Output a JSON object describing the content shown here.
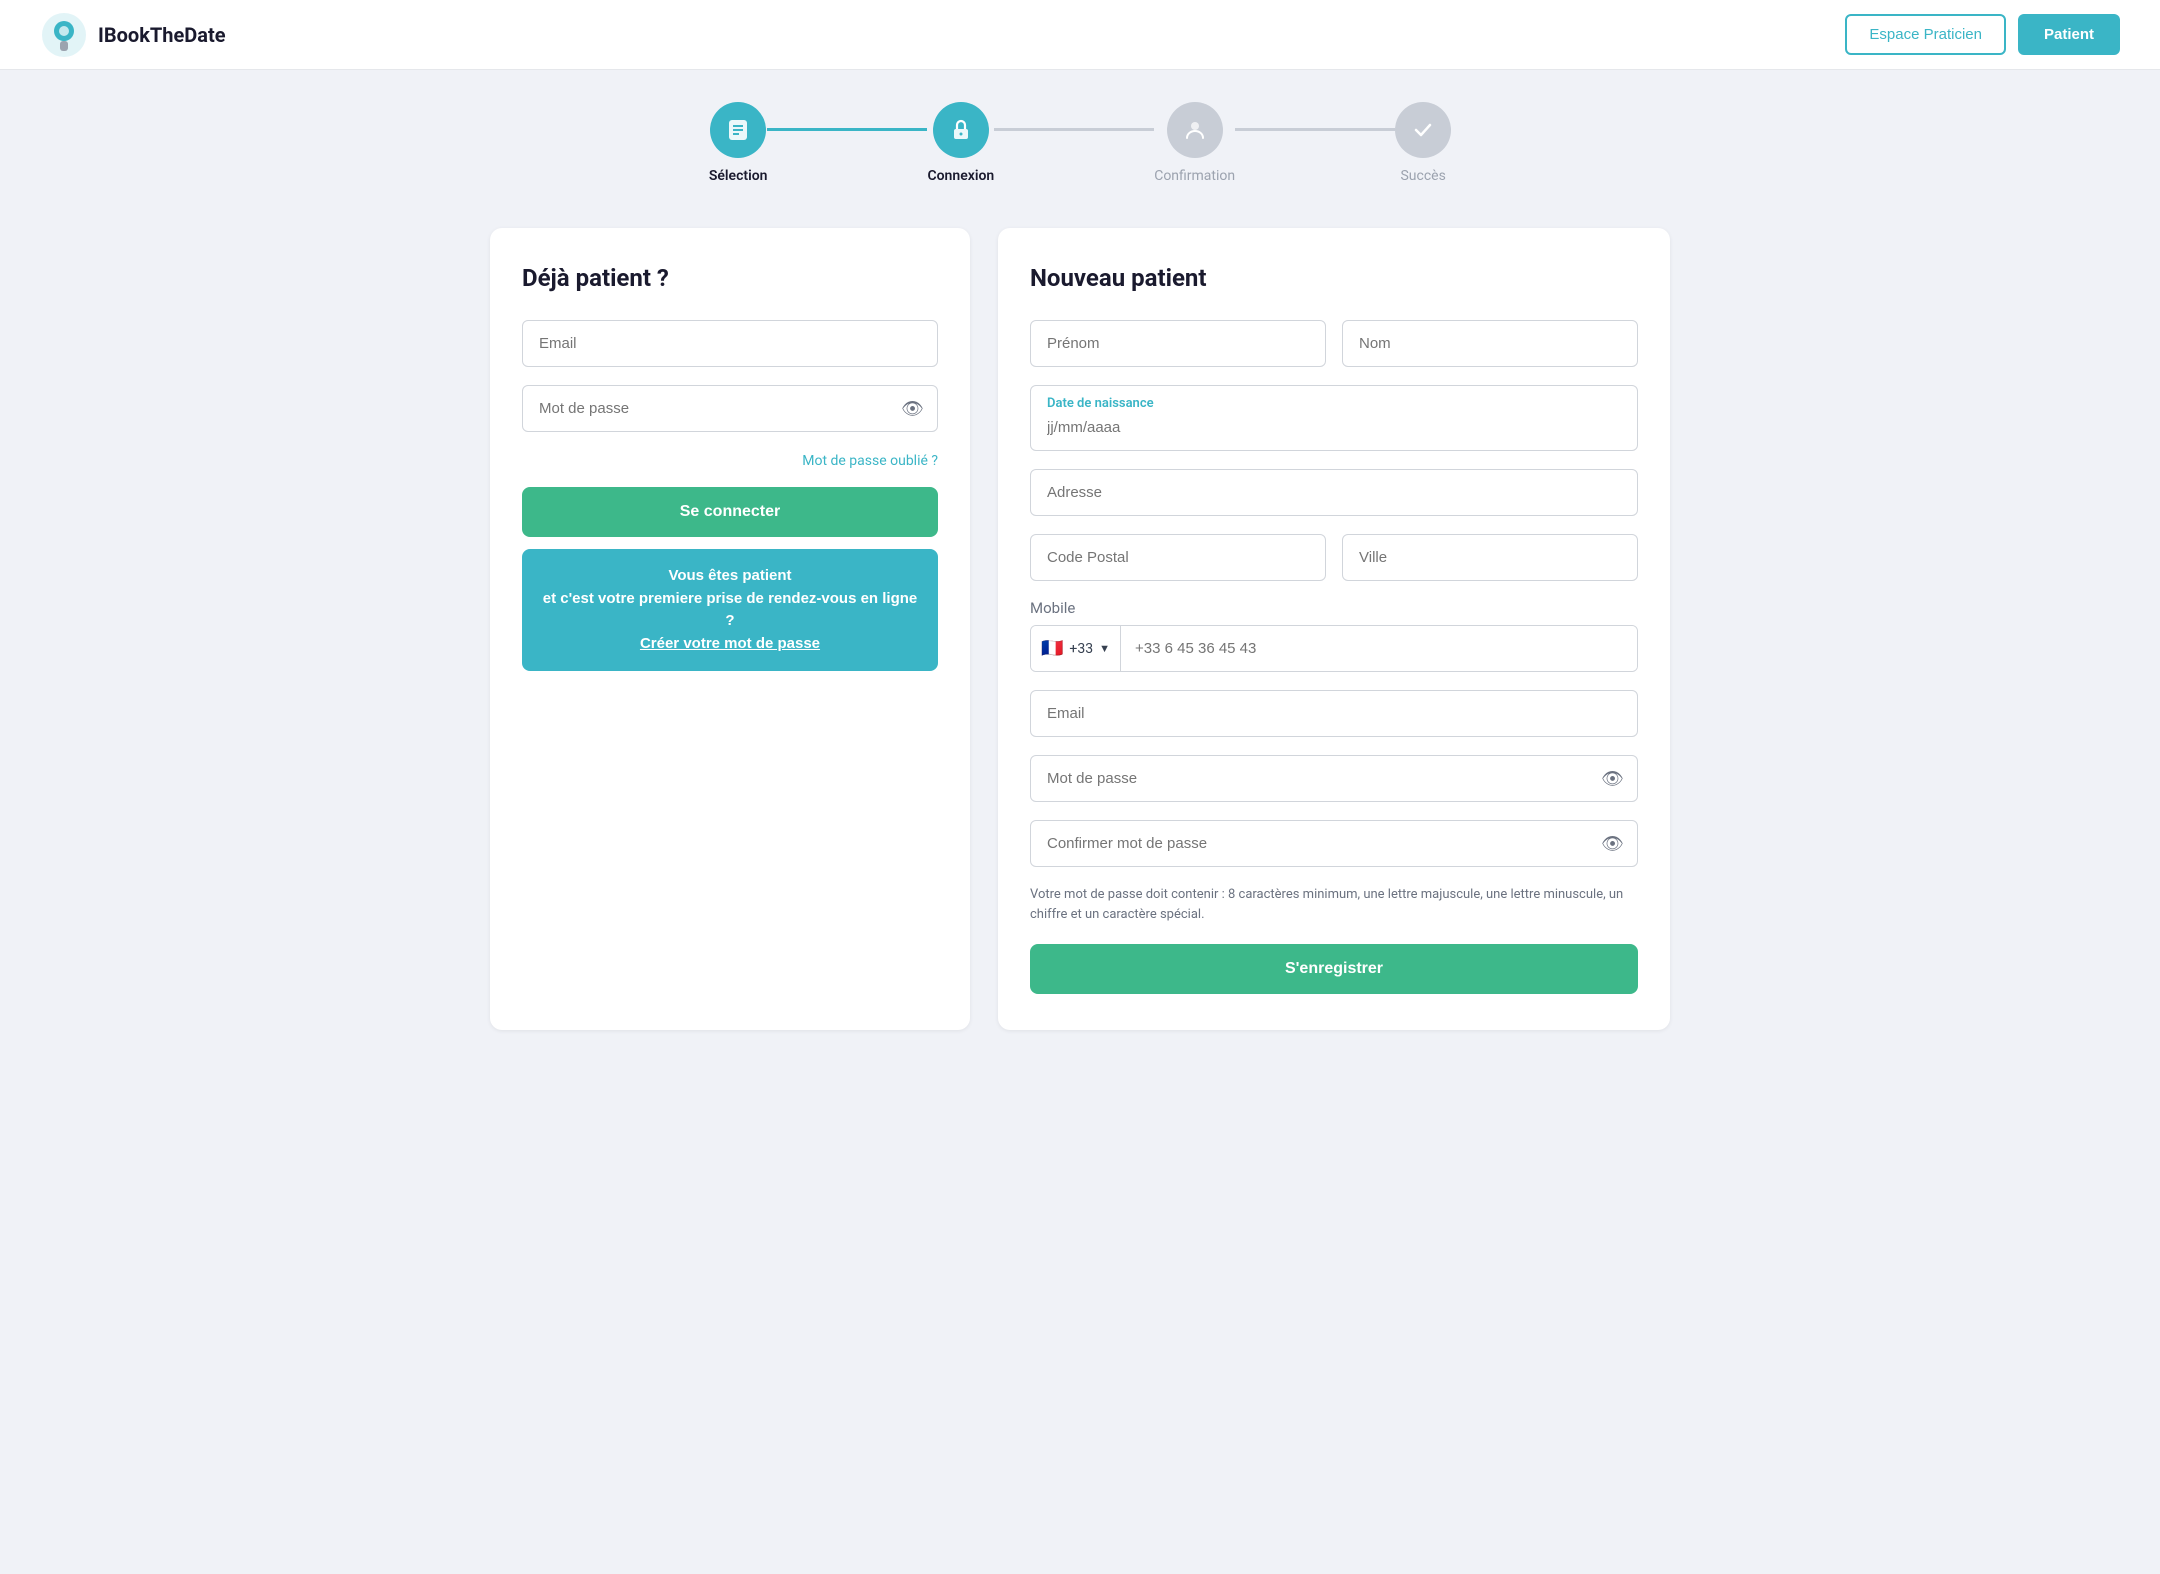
{
  "header": {
    "logo_text": "IBookTheDate",
    "btn_praticien": "Espace Praticien",
    "btn_patient": "Patient"
  },
  "stepper": {
    "steps": [
      {
        "id": "selection",
        "label": "Sélection",
        "state": "active",
        "icon": "📋"
      },
      {
        "id": "connexion",
        "label": "Connexion",
        "state": "active",
        "icon": "🔒"
      },
      {
        "id": "confirmation",
        "label": "Confirmation",
        "state": "inactive",
        "icon": "👤"
      },
      {
        "id": "succes",
        "label": "Succès",
        "state": "inactive",
        "icon": "✓"
      }
    ]
  },
  "existing_patient": {
    "title": "Déjà patient ?",
    "email_placeholder": "Email",
    "password_placeholder": "Mot de passe",
    "forgot_password": "Mot de passe oublié ?",
    "login_button": "Se connecter",
    "new_account_line1": "Vous êtes patient",
    "new_account_line2": "et c'est votre premiere prise de rendez-vous en ligne ?",
    "new_account_line3": "Créer votre mot de passe"
  },
  "new_patient": {
    "title": "Nouveau patient",
    "prenom_placeholder": "Prénom",
    "nom_placeholder": "Nom",
    "date_label": "Date de naissance",
    "date_placeholder": "jj/mm/aaaa",
    "adresse_placeholder": "Adresse",
    "code_postal_placeholder": "Code Postal",
    "ville_placeholder": "Ville",
    "mobile_label": "Mobile",
    "phone_flag": "🇫🇷",
    "phone_code": "+33",
    "phone_placeholder": "+33 6 45 36 45 43",
    "email_placeholder": "Email",
    "password_placeholder": "Mot de passe",
    "confirm_password_placeholder": "Confirmer mot de passe",
    "password_hint": "Votre mot de passe doit contenir : 8 caractères minimum, une lettre majuscule, une lettre minuscule, un chiffre et un caractère spécial.",
    "register_button": "S'enregistrer"
  }
}
